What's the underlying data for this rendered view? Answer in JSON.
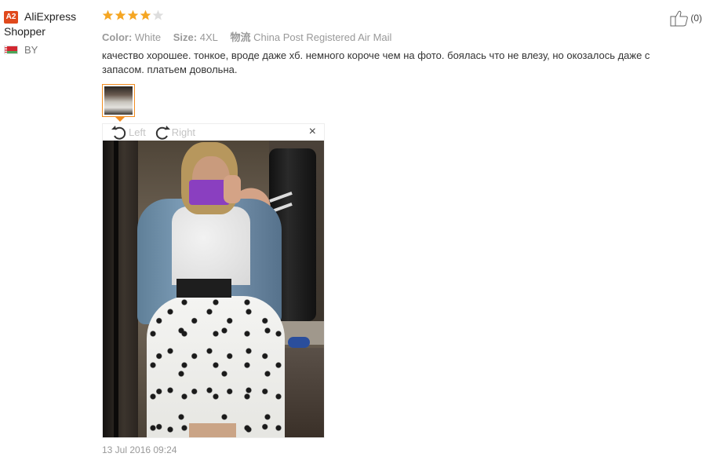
{
  "user": {
    "level_badge": "A2",
    "name_line1": "AliExpress",
    "name_line2": "Shopper",
    "country": "BY"
  },
  "review": {
    "rating": 4,
    "rating_max": 5,
    "star_color": "#f5a623",
    "meta": {
      "color_key": "Color:",
      "color_val": "White",
      "size_key": "Size:",
      "size_val": "4XL",
      "logistics_key": "物流",
      "logistics_val": "China Post Registered Air Mail"
    },
    "text": "качество хорошее. тонкое, вроде даже хб. немного короче чем на фото. боялась что не влезу, но окозалось даже с запасом. платьем довольна.",
    "viewer": {
      "rotate_left": "Left",
      "rotate_right": "Right",
      "close": "×"
    },
    "date": "13 Jul 2016 09:24"
  },
  "helpful": {
    "count": "(0)"
  },
  "colors": {
    "accent": "#f18c1f",
    "badge": "#e0491c"
  }
}
